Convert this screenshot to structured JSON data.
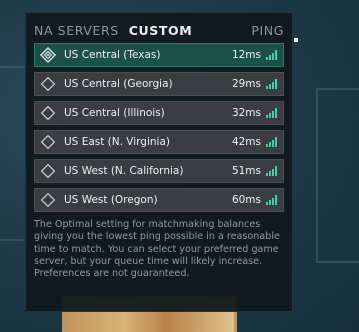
{
  "tabs": [
    {
      "label": "NA SERVERS",
      "active": false
    },
    {
      "label": "CUSTOM",
      "active": true
    }
  ],
  "ping_header": "PING",
  "servers": [
    {
      "name": "US Central (Texas)",
      "ping": "12ms",
      "selected": true,
      "signal_icon": "signal-bars-icon",
      "row_icon": "selected-diamond-icon"
    },
    {
      "name": "US Central (Georgia)",
      "ping": "29ms",
      "selected": false,
      "signal_icon": "signal-bars-icon",
      "row_icon": "diamond-icon"
    },
    {
      "name": "US Central (Illinois)",
      "ping": "32ms",
      "selected": false,
      "signal_icon": "signal-bars-icon",
      "row_icon": "diamond-icon"
    },
    {
      "name": "US East (N. Virginia)",
      "ping": "42ms",
      "selected": false,
      "signal_icon": "signal-bars-icon",
      "row_icon": "diamond-icon"
    },
    {
      "name": "US West (N. California)",
      "ping": "51ms",
      "selected": false,
      "signal_icon": "signal-bars-icon",
      "row_icon": "diamond-icon"
    },
    {
      "name": "US West (Oregon)",
      "ping": "60ms",
      "selected": false,
      "signal_icon": "signal-bars-icon",
      "row_icon": "diamond-icon"
    }
  ],
  "description": "The Optimal setting for matchmaking balances giving you the lowest ping possible in a reasonable time to match. You can select your preferred game server, but your queue time will likely increase. Preferences are not guaranteed.",
  "colors": {
    "panel_bg": "#10181e",
    "row_bg": "#3a3e42",
    "selected_row_bg": "#1b5149",
    "signal_green": "#3fd3a4",
    "text_primary": "#eef1f3",
    "text_muted": "#8f9aa2"
  }
}
